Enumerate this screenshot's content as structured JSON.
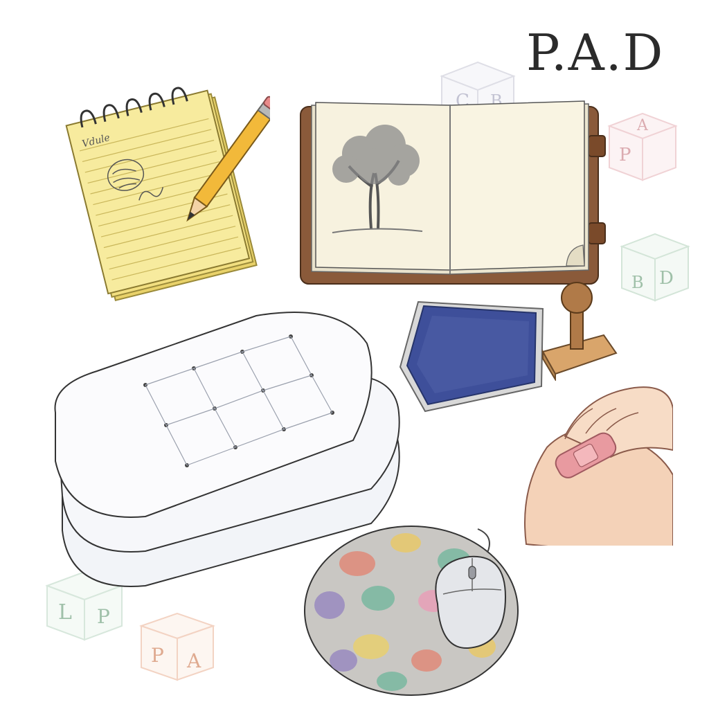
{
  "header": {
    "title": "P.A.D"
  },
  "notepad": {
    "scribble": "Vdule"
  },
  "blocks": [
    {
      "letters": [
        "A",
        "P"
      ],
      "color": "#e8b4b8"
    },
    {
      "letters": [
        "D",
        "B"
      ],
      "color": "#b9d8c0"
    },
    {
      "letters": [
        "L",
        "P"
      ],
      "color": "#b9d8c0"
    },
    {
      "letters": [
        "P",
        "A"
      ],
      "color": "#f0b89a"
    },
    {
      "letters": [
        "C",
        "B"
      ],
      "color": "#c8c8d8"
    }
  ],
  "colors": {
    "notepad": "#f7eb9e",
    "notebook_cover": "#8a5a3a",
    "ink_pad": "#3e4f9a",
    "bandage": "#e89aa0",
    "skin": "#f4d2b8",
    "mousepad": "#c9c7c3"
  },
  "icons": [
    "notepad-icon",
    "pencil-icon",
    "sketchbook-icon",
    "tree-sketch-icon",
    "ink-pad-icon",
    "rubber-stamp-icon",
    "cushion-stack-icon",
    "mouse-pad-icon",
    "computer-mouse-icon",
    "knee-bandage-icon",
    "letter-block-icon"
  ]
}
